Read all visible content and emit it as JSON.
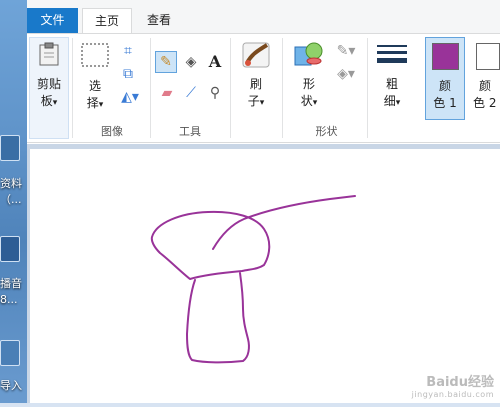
{
  "desktop": {
    "labels": [
      "资料",
      "（...",
      "播音",
      "8...",
      "导入"
    ]
  },
  "tabs": {
    "file": "文件",
    "home": "主页",
    "view": "查看"
  },
  "ribbon": {
    "clipboard": {
      "line1": "剪贴",
      "line2": "板",
      "arrow": "▾"
    },
    "select": {
      "line1": "选",
      "line2": "择",
      "arrow": "▾"
    },
    "brush": {
      "line1": "刷",
      "line2": "子",
      "arrow": "▾"
    },
    "shapes": {
      "line1": "形",
      "line2": "状",
      "arrow": "▾"
    },
    "size": {
      "line1": "粗",
      "line2": "细",
      "arrow": "▾"
    },
    "color1": {
      "line1": "颜",
      "line2": "色 1"
    },
    "color2": {
      "line1": "颜",
      "line2": "色 2"
    },
    "groups": {
      "image": "图像",
      "tools": "工具",
      "shapes": "形状"
    },
    "colors": {
      "color1": "#993399",
      "color2": "#ffffff",
      "accent": "#1979ca"
    }
  },
  "watermark": {
    "main": "Baidu经验",
    "sub": "jingyan.baidu.com"
  }
}
